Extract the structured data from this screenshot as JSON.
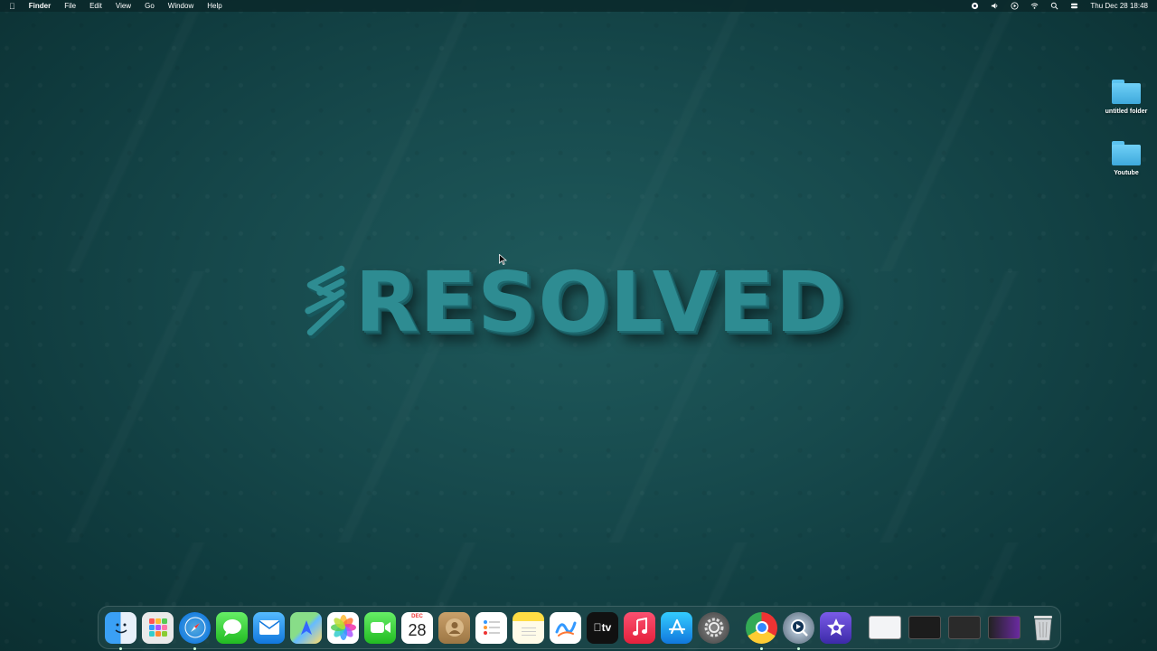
{
  "menubar": {
    "app_name": "Finder",
    "menus": [
      "File",
      "Edit",
      "View",
      "Go",
      "Window",
      "Help"
    ],
    "clock": "Thu Dec 28  18:48"
  },
  "desktop": {
    "icons": [
      {
        "label": "untitled folder"
      },
      {
        "label": "Youtube"
      }
    ]
  },
  "wallpaper": {
    "logo_text": "RESOLVED"
  },
  "dock": {
    "calendar": {
      "month": "DEC",
      "day": "28"
    },
    "tv_label": "tv"
  },
  "colors": {
    "wallpaper": "#174a4d",
    "logo": "#2e8c92",
    "folder": "#5bc3ef"
  }
}
